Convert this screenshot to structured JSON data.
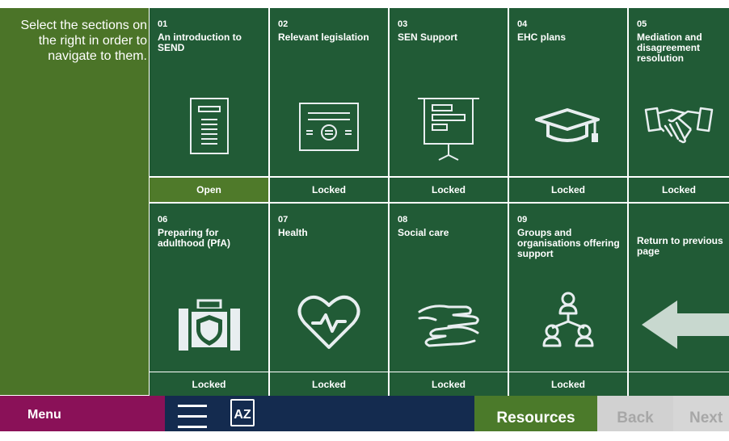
{
  "instructions": "Select the sections on the right in order to navigate to them.",
  "colors": {
    "tile": "#215b36",
    "tile_open_status": "#4f7a2a",
    "left_panel": "#4b7428",
    "menu": "#8a1158",
    "nav_dark": "#142b4f",
    "resources": "#4b7a2a",
    "disabled_bg": "#d1d1d1",
    "icon_stroke": "#e8eef0",
    "arrow_fill": "#c8d8cf"
  },
  "tiles": [
    {
      "num": "01",
      "title": "An introduction to SEND",
      "status": "Open",
      "icon": "document-icon"
    },
    {
      "num": "02",
      "title": "Relevant legislation",
      "status": "Locked",
      "icon": "certificate-icon"
    },
    {
      "num": "03",
      "title": "SEN Support",
      "status": "Locked",
      "icon": "presentation-board-icon"
    },
    {
      "num": "04",
      "title": "EHC plans",
      "status": "Locked",
      "icon": "graduation-cap-icon"
    },
    {
      "num": "05",
      "title": "Mediation and disagreement resolution",
      "status": "Locked",
      "icon": "handshake-icon"
    },
    {
      "num": "06",
      "title": "Preparing for adulthood (PfA)",
      "status": "Locked",
      "icon": "briefcase-shield-icon"
    },
    {
      "num": "07",
      "title": "Health",
      "status": "Locked",
      "icon": "heart-pulse-icon"
    },
    {
      "num": "08",
      "title": "Social care",
      "status": "Locked",
      "icon": "caring-hands-icon"
    },
    {
      "num": "09",
      "title": "Groups and organisations offering support",
      "status": "Locked",
      "icon": "group-network-icon"
    },
    {
      "num": "",
      "title": "Return to previous page",
      "status": "",
      "icon": "arrow-left-icon"
    }
  ],
  "bottom_bar": {
    "menu_label": "Menu",
    "hamburger_icon": "hamburger-icon",
    "az_label": "AZ",
    "resources_label": "Resources",
    "back_label": "Back",
    "next_label": "Next"
  }
}
